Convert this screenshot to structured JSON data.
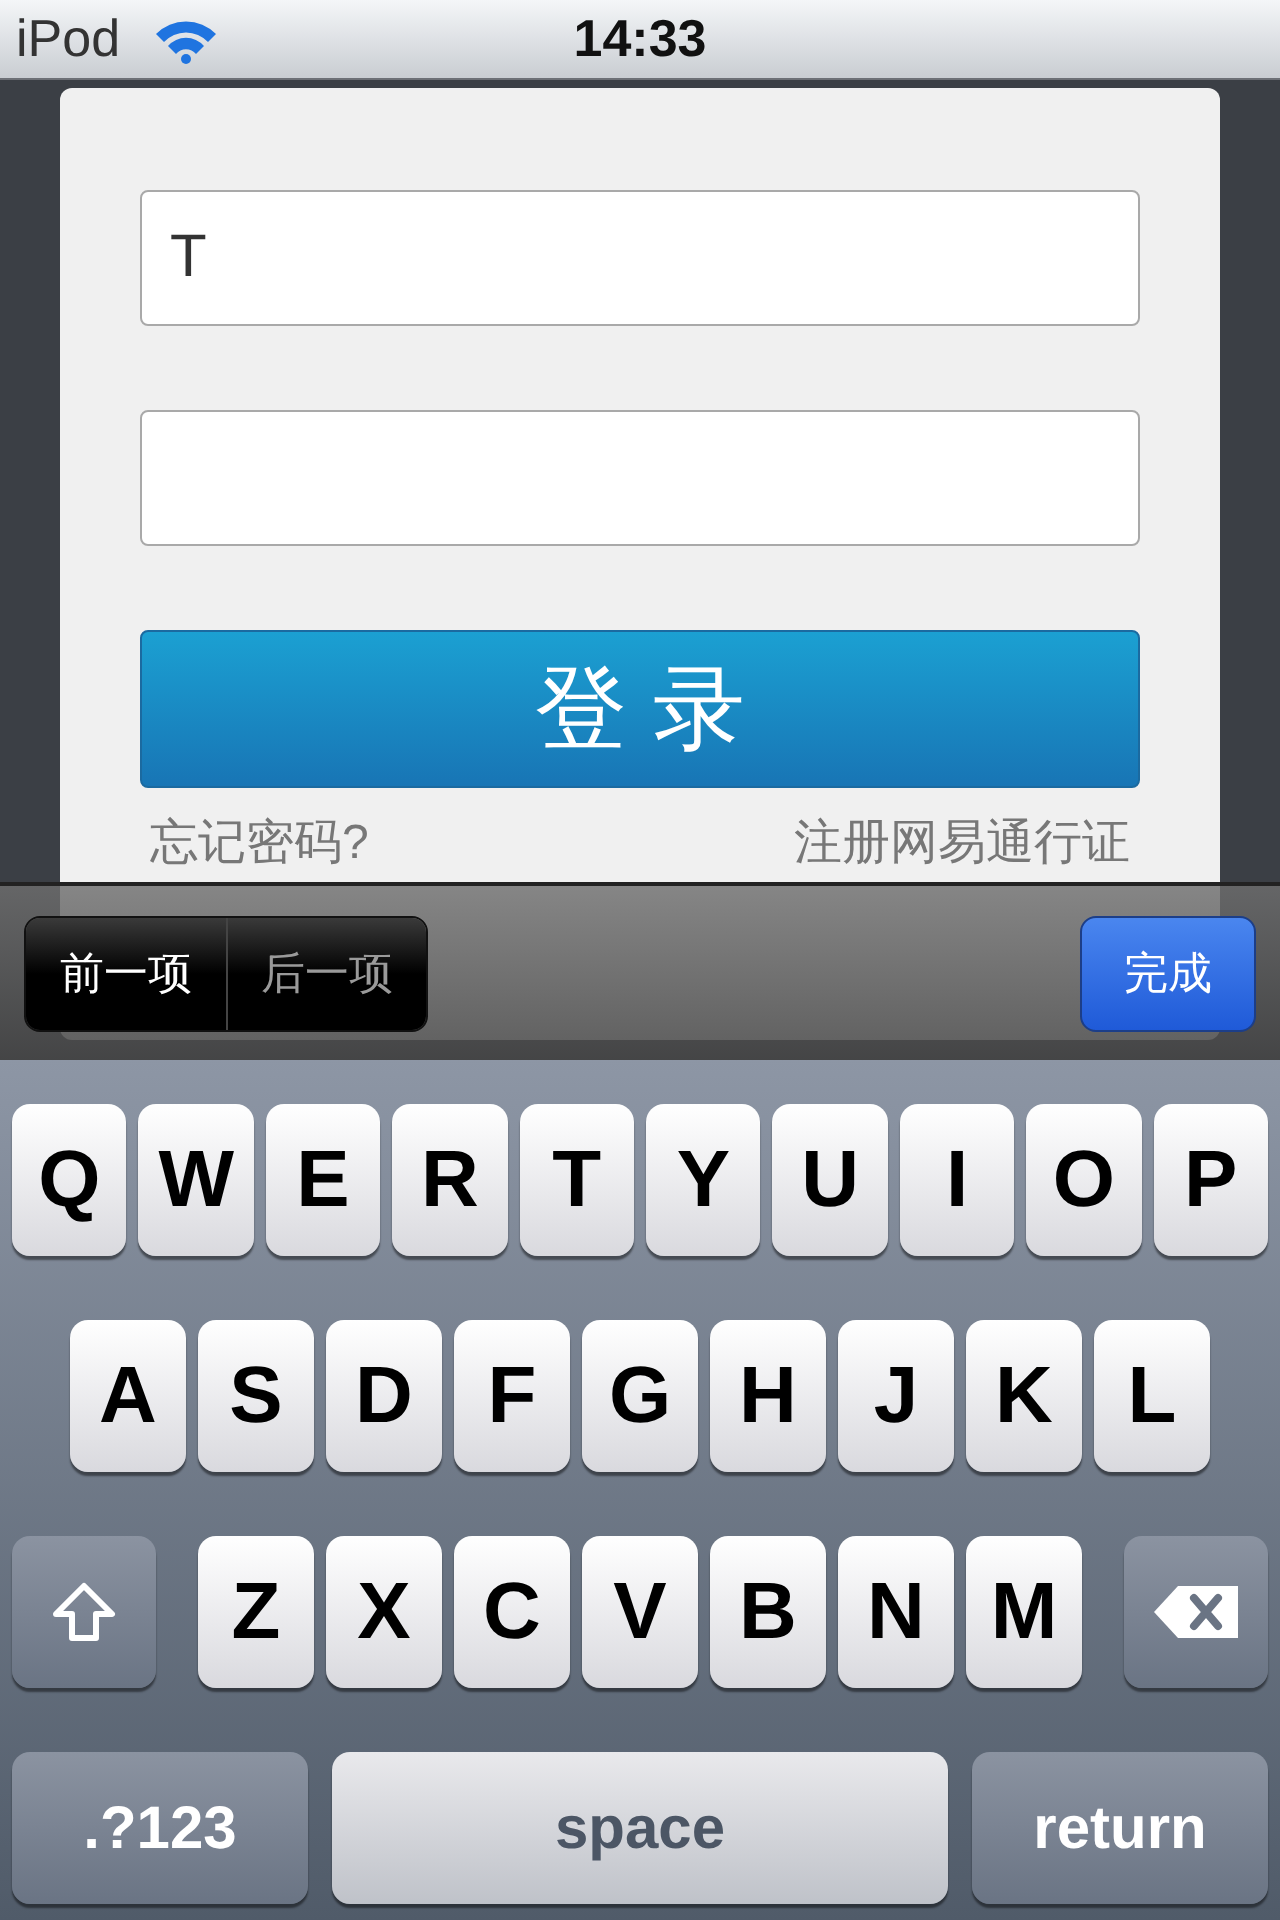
{
  "status_bar": {
    "carrier": "iPod",
    "time": "14:33"
  },
  "form": {
    "username_field": {
      "value": "T"
    },
    "login_button": "登 录",
    "links": [
      "忘记密码?",
      "注册网易通行证"
    ]
  },
  "toolbar": {
    "segments": [
      {
        "label": "前一项",
        "disabled": false
      },
      {
        "label": "后一项",
        "disabled": true
      }
    ],
    "done_button": "完成"
  },
  "keyboard": {
    "key_rows": [
      {
        "keys": [
          {
            "kind": "letter",
            "label": "Q"
          },
          {
            "kind": "letter",
            "label": "W"
          },
          {
            "kind": "letter",
            "label": "E"
          },
          {
            "kind": "letter",
            "label": "R"
          },
          {
            "kind": "letter",
            "label": "T"
          },
          {
            "kind": "letter",
            "label": "Y"
          },
          {
            "kind": "letter",
            "label": "U"
          },
          {
            "kind": "letter",
            "label": "I"
          },
          {
            "kind": "letter",
            "label": "O"
          },
          {
            "kind": "letter",
            "label": "P"
          }
        ]
      },
      {
        "keys": [
          {
            "kind": "letter",
            "label": "A"
          },
          {
            "kind": "letter",
            "label": "S"
          },
          {
            "kind": "letter",
            "label": "D"
          },
          {
            "kind": "letter",
            "label": "F"
          },
          {
            "kind": "letter",
            "label": "G"
          },
          {
            "kind": "letter",
            "label": "H"
          },
          {
            "kind": "letter",
            "label": "J"
          },
          {
            "kind": "letter",
            "label": "K"
          },
          {
            "kind": "letter",
            "label": "L"
          }
        ]
      },
      {
        "keys": [
          {
            "kind": "shift"
          },
          {
            "kind": "letter",
            "label": "Z"
          },
          {
            "kind": "letter",
            "label": "X"
          },
          {
            "kind": "letter",
            "label": "C"
          },
          {
            "kind": "letter",
            "label": "V"
          },
          {
            "kind": "letter",
            "label": "B"
          },
          {
            "kind": "letter",
            "label": "N"
          },
          {
            "kind": "letter",
            "label": "M"
          },
          {
            "kind": "delete"
          }
        ]
      },
      {
        "keys": [
          {
            "kind": "mode",
            "label": ".?123"
          },
          {
            "kind": "space",
            "label": "space"
          },
          {
            "kind": "return",
            "label": "return"
          }
        ]
      }
    ]
  }
}
